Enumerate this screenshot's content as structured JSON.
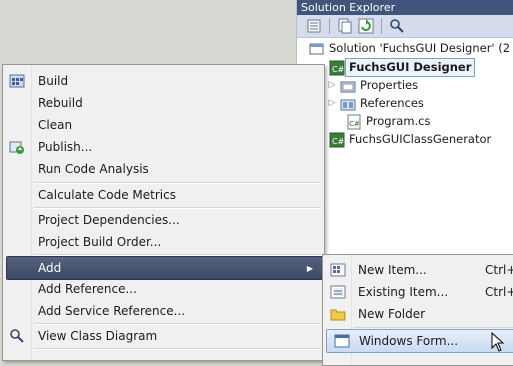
{
  "solution_explorer": {
    "title": "Solution Explorer",
    "toolbar": [
      "properties-icon",
      "show-all-files-icon",
      "refresh-icon",
      "class-diagram-icon"
    ],
    "tree": {
      "solution": "Solution 'FuchsGUI Designer' (2 p",
      "project_selected": "FuchsGUI Designer",
      "properties": "Properties",
      "references": "References",
      "program": "Program.cs",
      "project2": "FuchsGUIClassGenerator"
    }
  },
  "context_menu": {
    "build": "Build",
    "rebuild": "Rebuild",
    "clean": "Clean",
    "publish": "Publish...",
    "run_code_analysis": "Run Code Analysis",
    "calculate_code_metrics": "Calculate Code Metrics",
    "project_dependencies": "Project Dependencies...",
    "project_build_order": "Project Build Order...",
    "add": "Add",
    "add_reference": "Add Reference...",
    "add_service_reference": "Add Service Reference...",
    "view_class_diagram": "View Class Diagram"
  },
  "add_submenu": {
    "new_item": "New Item...",
    "new_item_shortcut": "Ctrl+",
    "existing_item": "Existing Item...",
    "existing_item_shortcut": "Ctrl+",
    "new_folder": "New Folder",
    "windows_form": "Windows Form..."
  },
  "colors": {
    "panel_title": "#41557c",
    "menu_highlight": "#4a5672",
    "submenu_highlight": "#c9dbf3"
  }
}
